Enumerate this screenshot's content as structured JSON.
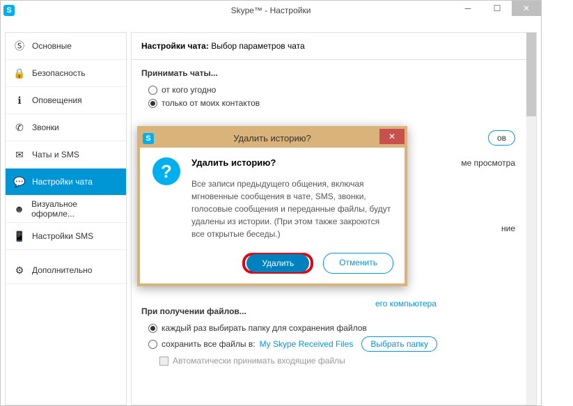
{
  "window": {
    "title": "Skype™ - Настройки",
    "logo_letter": "S"
  },
  "sidebar": {
    "items": [
      {
        "label": "Основные"
      },
      {
        "label": "Безопасность"
      },
      {
        "label": "Оповещения"
      },
      {
        "label": "Звонки"
      },
      {
        "label": "Чаты и SMS"
      },
      {
        "label": "Настройки чата"
      },
      {
        "label": "Визуальное оформле..."
      },
      {
        "label": "Настройки SMS"
      },
      {
        "label": "Дополнительно"
      }
    ]
  },
  "panel": {
    "head_label": "Настройки чата:",
    "head_value": "Выбор параметров чата",
    "accept_title": "Принимать чаты...",
    "opt_anyone": "от кого угодно",
    "opt_contacts": "только от моих контактов",
    "frag_ov": "ов",
    "frag_view": "ме просмотра",
    "frag_nie": "ние",
    "frag_comp": "его компьютера",
    "receive_title": "При получении файлов...",
    "opt_choose": "каждый раз выбирать папку для сохранения файлов",
    "opt_save_prefix": "сохранить все файлы в:",
    "opt_save_folder": "My Skype Received Files",
    "btn_choose_folder": "Выбрать папку",
    "chk_auto": "Автоматически принимать входящие файлы"
  },
  "dialog": {
    "title": "Удалить историю?",
    "heading": "Удалить историю?",
    "body": "Все записи предыдущего общения, включая мгновенные сообщения в чате, SMS, звонки, голосовые сообщения и переданные файлы, будут удалены из истории. (При этом также закроются все открытые беседы.)",
    "btn_primary": "Удалить",
    "btn_secondary": "Отменить",
    "logo_letter": "S"
  }
}
